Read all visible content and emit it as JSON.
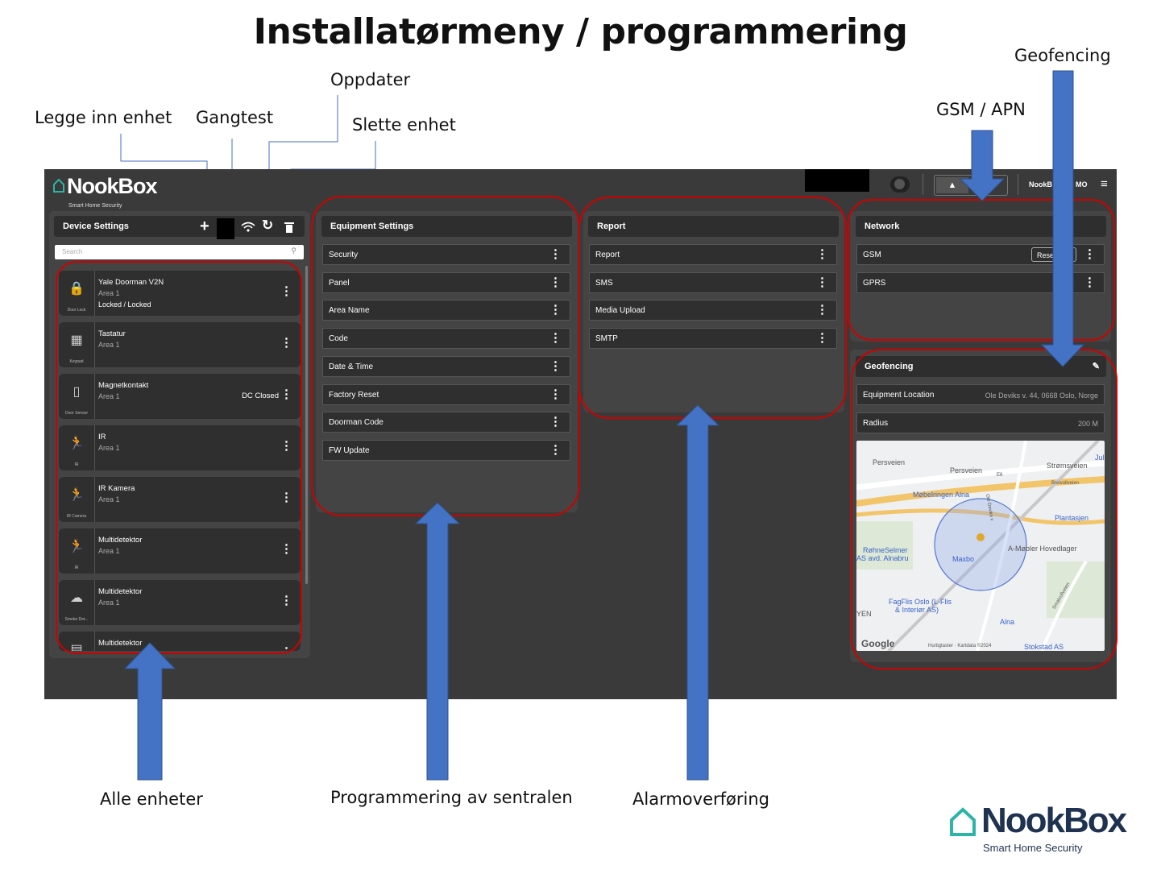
{
  "title": "Installatørmeny / programmering",
  "annotations": {
    "legge_inn_enhet": "Legge inn enhet",
    "gangtest": "Gangtest",
    "oppdater": "Oppdater",
    "slette_enhet": "Slette enhet",
    "geofencing": "Geofencing",
    "gsm_apn": "GSM / APN",
    "alle_enheter": "Alle enheter",
    "programmering_av_sentralen": "Programmering av sentralen",
    "alarmoverforing": "Alarmoverføring"
  },
  "app": {
    "logo": {
      "name": "NookBox",
      "tagline": "Smart Home Security"
    },
    "topbar": {
      "user": "NookB",
      "user_suffix": "MO"
    },
    "device_settings": {
      "title": "Device Settings",
      "search_placeholder": "Search",
      "devices": [
        {
          "name": "Yale Doorman V2N",
          "area": "Area 1",
          "status": "Locked / Locked",
          "type_label": "Door Lock",
          "icon": "door-lock-icon",
          "glyph": "🔒",
          "right": ""
        },
        {
          "name": "Tastatur",
          "area": "Area 1",
          "status": "",
          "type_label": "Keypad",
          "icon": "keypad-icon",
          "glyph": "▦",
          "right": ""
        },
        {
          "name": "Magnetkontakt",
          "area": "Area 1",
          "status": "",
          "type_label": "Door Sensor",
          "icon": "door-sensor-icon",
          "glyph": "▯",
          "right": "DC Closed"
        },
        {
          "name": "IR",
          "area": "Area 1",
          "status": "",
          "type_label": "IR",
          "icon": "motion-sensor-icon",
          "glyph": "🏃",
          "right": ""
        },
        {
          "name": "IR Kamera",
          "area": "Area 1",
          "status": "",
          "type_label": "IR Camera",
          "icon": "ir-camera-icon",
          "glyph": "🏃",
          "right": ""
        },
        {
          "name": "Multidetektor",
          "area": "Area 1",
          "status": "",
          "type_label": "IR",
          "icon": "multi-detector-icon",
          "glyph": "🏃",
          "right": ""
        },
        {
          "name": "Multidetektor",
          "area": "Area 1",
          "status": "",
          "type_label": "Smoke Det...",
          "icon": "smoke-detector-icon",
          "glyph": "☁",
          "right": ""
        },
        {
          "name": "Multidetektor",
          "area": "",
          "status": "",
          "type_label": "",
          "icon": "multi-detector-icon",
          "glyph": "▤",
          "right": ""
        }
      ]
    },
    "equipment_settings": {
      "title": "Equipment Settings",
      "items": [
        "Security",
        "Panel",
        "Area Name",
        "Code",
        "Date & Time",
        "Factory Reset",
        "Doorman Code",
        "FW Update"
      ]
    },
    "report": {
      "title": "Report",
      "items": [
        "Report",
        "SMS",
        "Media Upload",
        "SMTP"
      ]
    },
    "network": {
      "title": "Network",
      "items": [
        "GSM",
        "GPRS"
      ],
      "gsm_button": "Rese"
    },
    "geofencing": {
      "title": "Geofencing",
      "location_label": "Equipment Location",
      "location_value": "Ole Deviks v. 44, 0668 Oslo, Norge",
      "radius_label": "Radius",
      "radius_value": "200 M",
      "map_labels": {
        "perstveien_left": "Persveien",
        "perstveien_right": "Persveien",
        "stromsveien": "Strømsveien",
        "jul": "Jul",
        "breivollveien": "Breivollveien",
        "mobelringen": "Møbelringen Alna",
        "plantasjen": "Plantasjen",
        "amoler": "A-Møbler Hovedlager",
        "rohne_1": "RøhneSelmer",
        "rohne_2": "AS avd. Alnabru",
        "maxbo": "Maxbo",
        "fagflis_1": "FagFlis Oslo (L-Flis",
        "fagflis_2": "& Interiør AS)",
        "yen": "YEN",
        "alna": "Alna",
        "smalvollveien": "Smalvollveien",
        "google": "Google",
        "attribution": "Hurtigtaster · Kartdata ©2024",
        "stokstad": "Stokstad AS",
        "e6": "E6",
        "ole_deviks": "Ole Deviks v"
      }
    }
  },
  "brand_footer": {
    "name": "NookBox",
    "tagline": "Smart Home Security"
  },
  "colors": {
    "arrow": "#4472c4",
    "highlight": "#d00000",
    "app_bg": "#3a3a3a",
    "brand_teal": "#2bb5a6",
    "brand_dark": "#1f3350"
  }
}
